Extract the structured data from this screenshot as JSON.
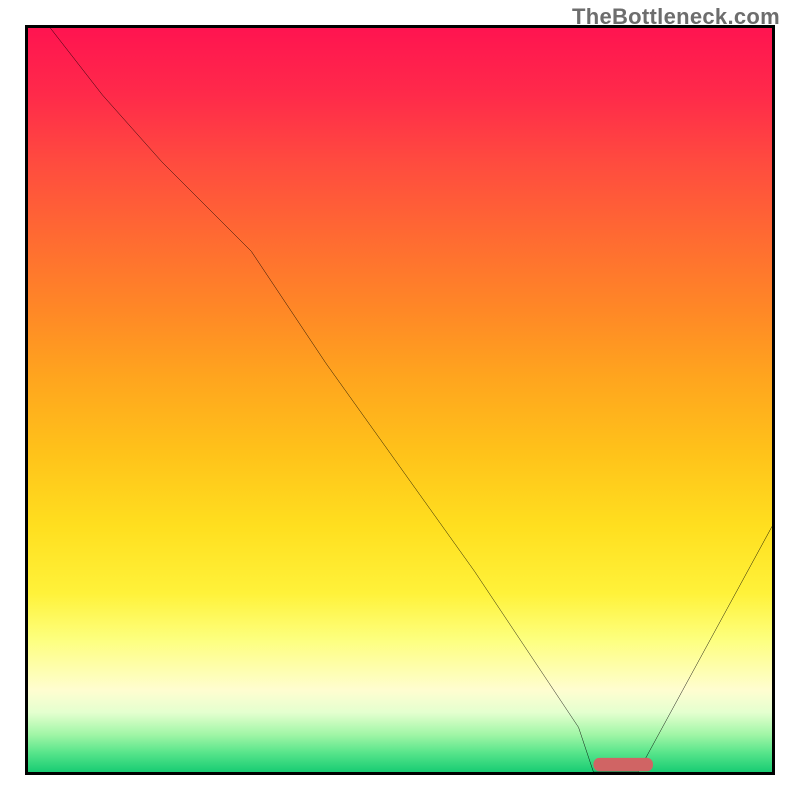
{
  "watermark": "TheBottleneck.com",
  "chart_data": {
    "type": "line",
    "title": "",
    "xlabel": "",
    "ylabel": "",
    "xlim": [
      0,
      100
    ],
    "ylim": [
      0,
      100
    ],
    "grid": false,
    "legend": false,
    "notes": "V-shaped bottleneck curve over vertical traffic-light gradient (red top to green bottom). Minimum (optimum) reached around x≈76–82, y≈0. No axis ticks or numeric labels are shown; x/y values are positional estimates in percent of plot area.",
    "series": [
      {
        "name": "bottleneck-curve",
        "x": [
          3,
          10,
          18,
          26,
          30,
          40,
          50,
          60,
          70,
          74,
          76,
          82,
          88,
          94,
          100
        ],
        "values": [
          100,
          91,
          82,
          74,
          70,
          55,
          41,
          27,
          12,
          6,
          0,
          0,
          11,
          22,
          33
        ],
        "color": "#000000"
      }
    ],
    "annotations": [
      {
        "name": "optimum-marker",
        "shape": "pill",
        "x_range": [
          76,
          84
        ],
        "y": 1,
        "color": "#d06464"
      }
    ],
    "background_gradient": {
      "direction": "vertical",
      "stops": [
        {
          "pos": 0.0,
          "color": "#ff1450"
        },
        {
          "pos": 0.18,
          "color": "#ff4b3f"
        },
        {
          "pos": 0.38,
          "color": "#ff8826"
        },
        {
          "pos": 0.57,
          "color": "#ffc21a"
        },
        {
          "pos": 0.76,
          "color": "#fff23a"
        },
        {
          "pos": 0.89,
          "color": "#fffdd0"
        },
        {
          "pos": 0.95,
          "color": "#a0f6a6"
        },
        {
          "pos": 1.0,
          "color": "#18cc73"
        }
      ]
    }
  }
}
